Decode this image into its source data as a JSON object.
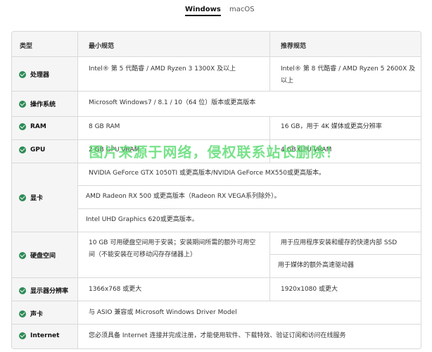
{
  "tabs": [
    {
      "label": "Windows",
      "active": true
    },
    {
      "label": "macOS",
      "active": false
    }
  ],
  "headers": {
    "type": "类型",
    "min": "最小规范",
    "rec": "推荐规范"
  },
  "rows": [
    {
      "name": "处理器",
      "min": "Intel® 第 5 代酷睿 / AMD Ryzen 3 1300X 及以上",
      "rec": "Intel® 第 8 代酷睿 / AMD Ryzen 5 2600X 及以上"
    },
    {
      "name": "操作系统",
      "min": "Microsoft Windows7 / 8.1 / 10（64 位）版本或更高版本"
    },
    {
      "name": "RAM",
      "min": "8 GB RAM",
      "rec": "16 GB，用于 4K 媒体或更高分辨率"
    },
    {
      "name": "GPU",
      "min": "2 GB GPU VRAM",
      "rec": "4 GB GPU VRAM"
    },
    {
      "name": "显卡",
      "lines": [
        "NVIDIA GeForce GTX 1050TI 或更高版本/NVIDIA GeForce MX550或更高版本。",
        "AMD Radeon RX 500 或更高版本（Radeon RX VEGA系列除外）。",
        "Intel UHD Graphics 620或更高版本。"
      ]
    },
    {
      "name": "硬盘空间",
      "min": "10 GB 可用硬盘空间用于安装；安装期间所需的额外可用空间（不能安装在可移动闪存存储器上）",
      "rec1": "用于应用程序安装和缓存的快速内部 SSD",
      "rec2": "用于媒体的额外高速驱动器"
    },
    {
      "name": "显示器分辨率",
      "min": "1366x768 或更大",
      "rec": "1920x1080 或更大"
    },
    {
      "name": "声卡",
      "min": "与 ASIO 兼容或 Microsoft Windows Driver Model"
    },
    {
      "name": "Internet",
      "min": "您必须具备 Internet 连接并完成注册，才能使用软件、下载特效、验证订阅和访问在线服务"
    }
  ],
  "watermark": "图片来源于网络，侵权联系站长删除！",
  "colors": {
    "check": "#2e8b57",
    "watermark": "#4cd964"
  }
}
